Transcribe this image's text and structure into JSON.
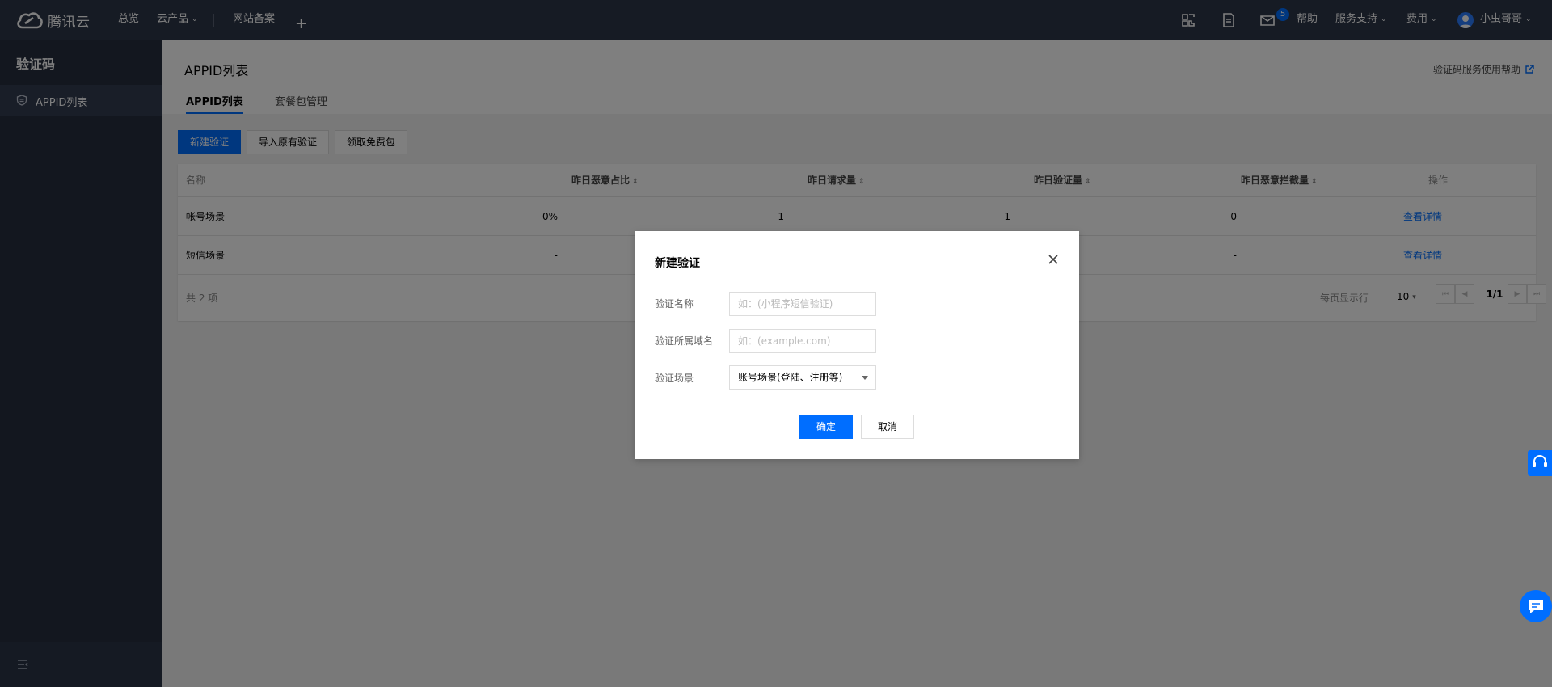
{
  "brand": {
    "name": "腾讯云"
  },
  "topnav": {
    "overview": "总览",
    "products": "云产品",
    "icp": "网站备案",
    "mail_badge": "5",
    "help": "帮助",
    "support": "服务支持",
    "billing": "费用",
    "user": "小虫哥哥"
  },
  "sidebar": {
    "title": "验证码",
    "items": [
      {
        "label": "APPID列表",
        "icon": "shield-icon"
      }
    ]
  },
  "page": {
    "title": "APPID列表",
    "help_link": "验证码服务使用帮助",
    "tabs": [
      {
        "label": "APPID列表",
        "active": true
      },
      {
        "label": "套餐包管理",
        "active": false
      }
    ]
  },
  "toolbar": {
    "new": "新建验证",
    "import": "导入原有验证",
    "free": "领取免费包"
  },
  "table": {
    "columns": [
      "名称",
      "昨日恶意占比",
      "昨日请求量",
      "昨日验证量",
      "昨日恶意拦截量",
      "操作"
    ],
    "rows": [
      {
        "name": "帐号场景",
        "ratio": "0%",
        "requests": "1",
        "verified": "1",
        "blocked": "0",
        "action": "查看详情"
      },
      {
        "name": "短信场景",
        "ratio": "-",
        "requests": "",
        "verified": "",
        "blocked": "-",
        "action": "查看详情"
      }
    ],
    "total": "共 2 项",
    "page_size_label": "每页显示行",
    "page_size": "10",
    "page": "1/1"
  },
  "modal": {
    "title": "新建验证",
    "name_label": "验证名称",
    "name_placeholder": "如：(小程序短信验证)",
    "domain_label": "验证所属域名",
    "domain_placeholder": "如：(example.com)",
    "scene_label": "验证场景",
    "scene_value": "账号场景(登陆、注册等)",
    "confirm": "确定",
    "cancel": "取消"
  },
  "colors": {
    "accent": "#006eff",
    "nav_bg": "#2d3648",
    "sidebar_bg": "#262f3e"
  }
}
